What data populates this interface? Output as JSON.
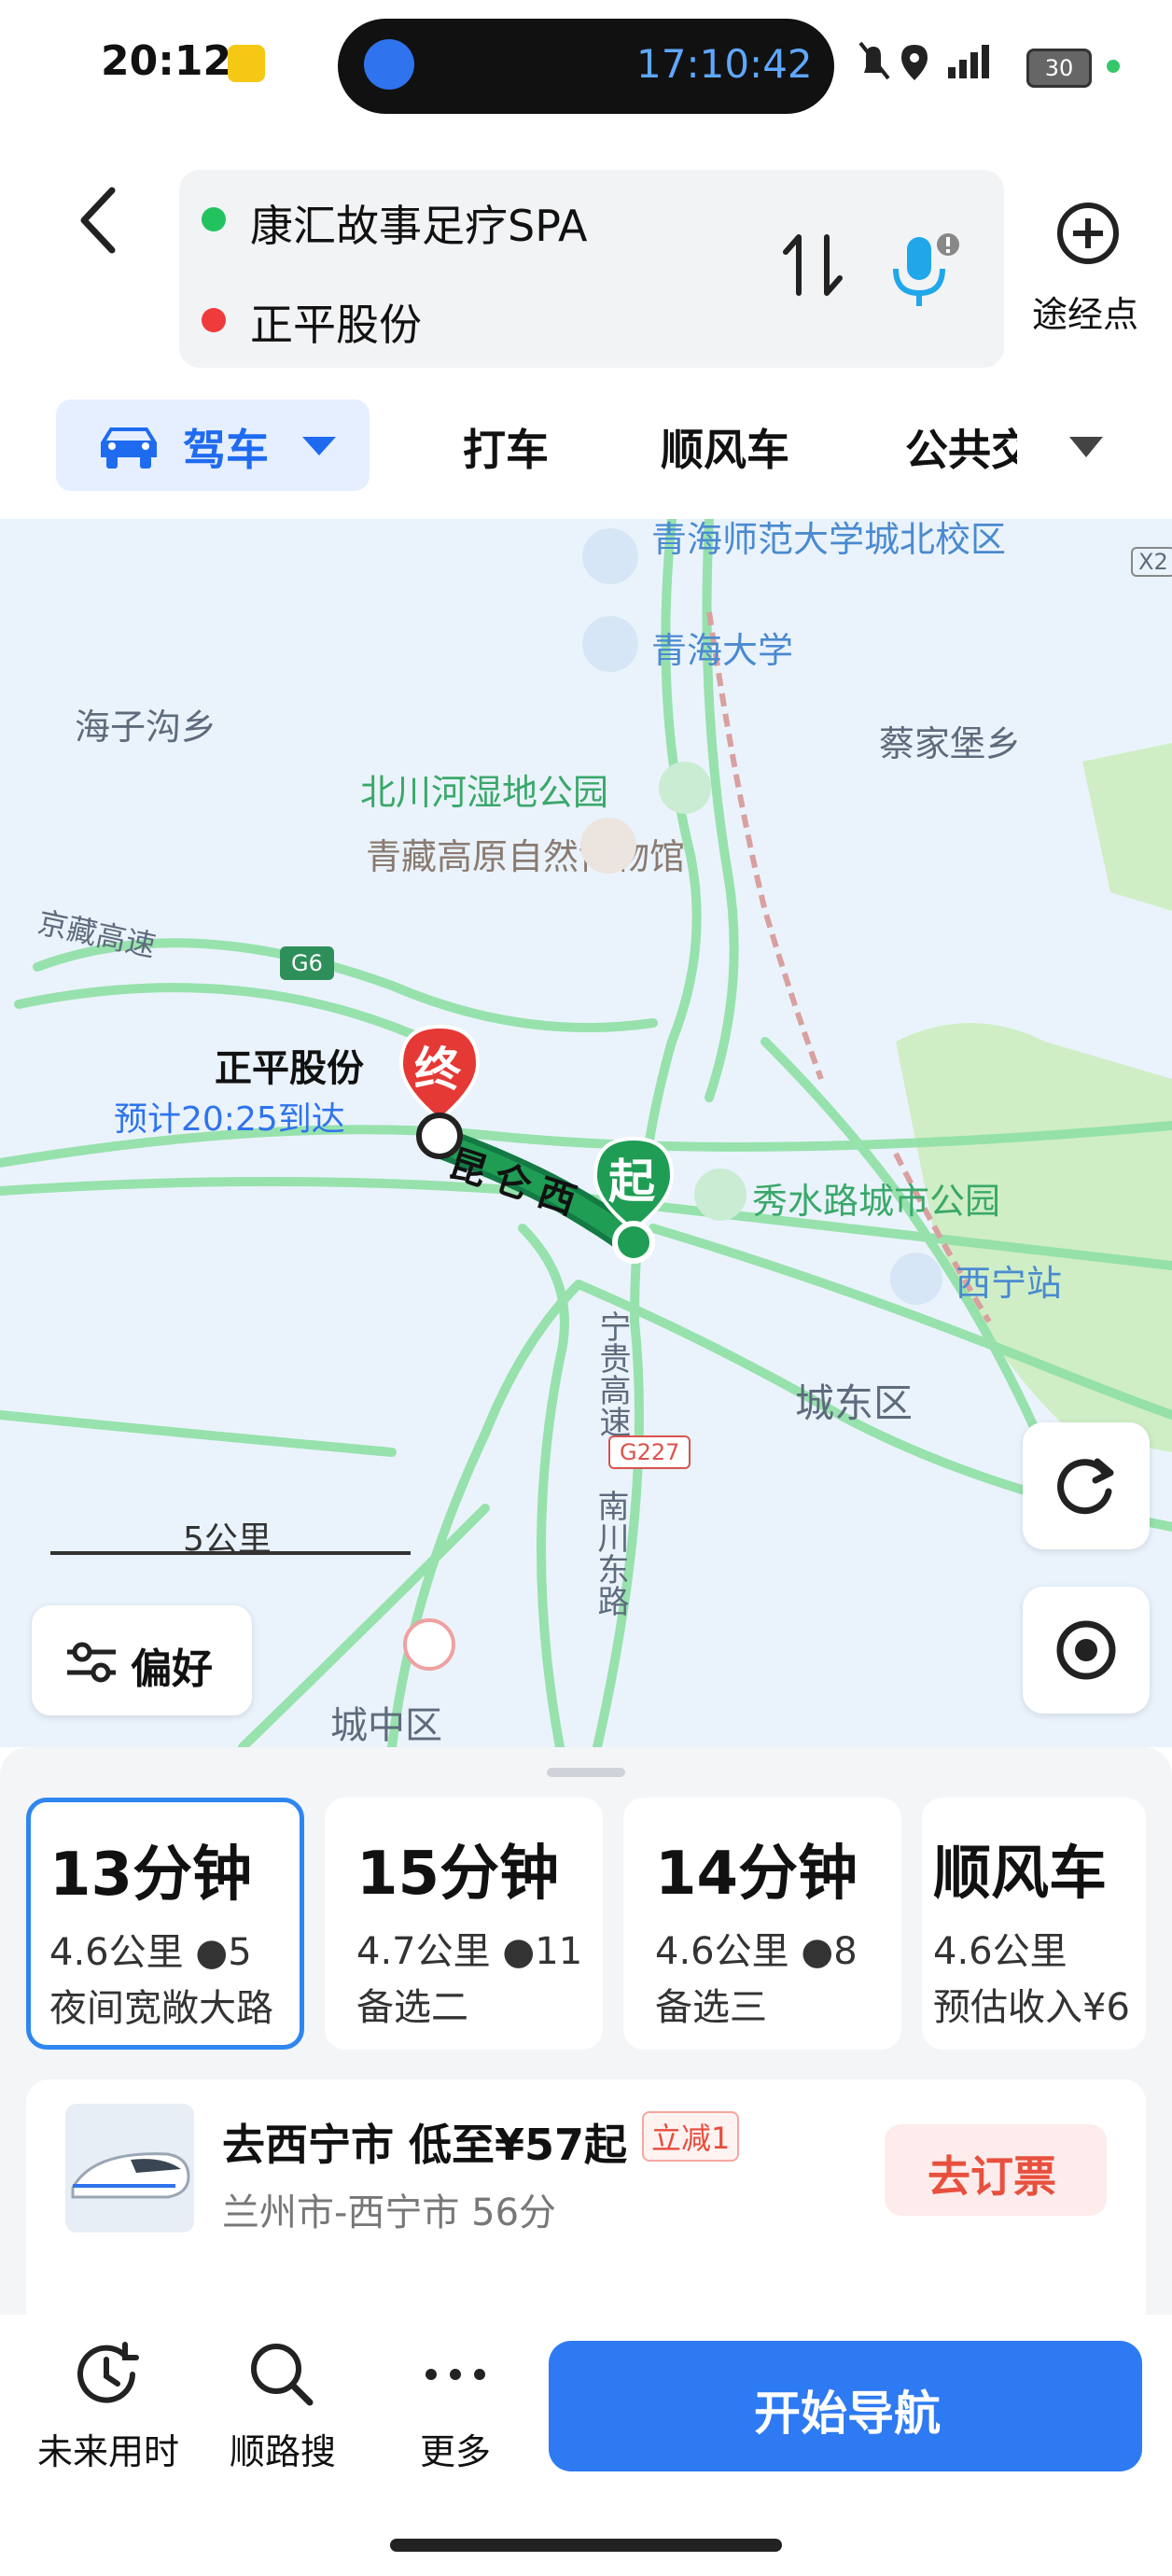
{
  "status": {
    "time": "20:12",
    "timer": "17:10:42",
    "battery": "30"
  },
  "route": {
    "origin": "康汇故事足疗SPA",
    "destination": "正平股份",
    "waypoint_label": "途经点"
  },
  "tabs": {
    "drive": "驾车",
    "taxi": "打车",
    "carpool": "顺风车",
    "transit": "公共交通"
  },
  "map": {
    "labels": {
      "qhnu": "青海师范大学城北校区",
      "qhu": "青海大学",
      "haizigou": "海子沟乡",
      "caijiabao": "蔡家堡乡",
      "beichuan": "北川河湿地公园",
      "museum": "青藏高原自然博物馆",
      "jingzang": "京藏高速",
      "g6": "G6",
      "dest_name": "正平股份",
      "eta": "预计20:25到达",
      "end_marker": "终",
      "start_marker": "起",
      "kunlun": "昆仑西",
      "xiushui": "秀水路城市公园",
      "xining_station": "西宁站",
      "chengdong": "城东区",
      "ninggui": "宁贵高速",
      "g227": "G227",
      "nanchuan": "南川东路",
      "chengzhong": "城中区",
      "x2": "X2"
    },
    "scale": "5公里",
    "preference": "偏好"
  },
  "routes": [
    {
      "time": "13分钟",
      "distance": "4.6公里",
      "lights": "5",
      "note": "夜间宽敞大路"
    },
    {
      "time": "15分钟",
      "distance": "4.7公里",
      "lights": "11",
      "note": "备选二"
    },
    {
      "time": "14分钟",
      "distance": "4.6公里",
      "lights": "8",
      "note": "备选三"
    },
    {
      "time": "顺风车",
      "distance": "4.6公里",
      "lights": "",
      "note": "预估收入¥6"
    }
  ],
  "promo": {
    "title": "去西宁市 低至¥57起",
    "badge": "立减1",
    "subtitle": "兰州市-西宁市 56分",
    "button": "去订票"
  },
  "bottom": {
    "future": "未来用时",
    "search": "顺路搜",
    "more": "更多",
    "start": "开始导航"
  },
  "colors": {
    "accent": "#2E7AF2",
    "route": "#1F9D55",
    "end": "#E53935"
  }
}
